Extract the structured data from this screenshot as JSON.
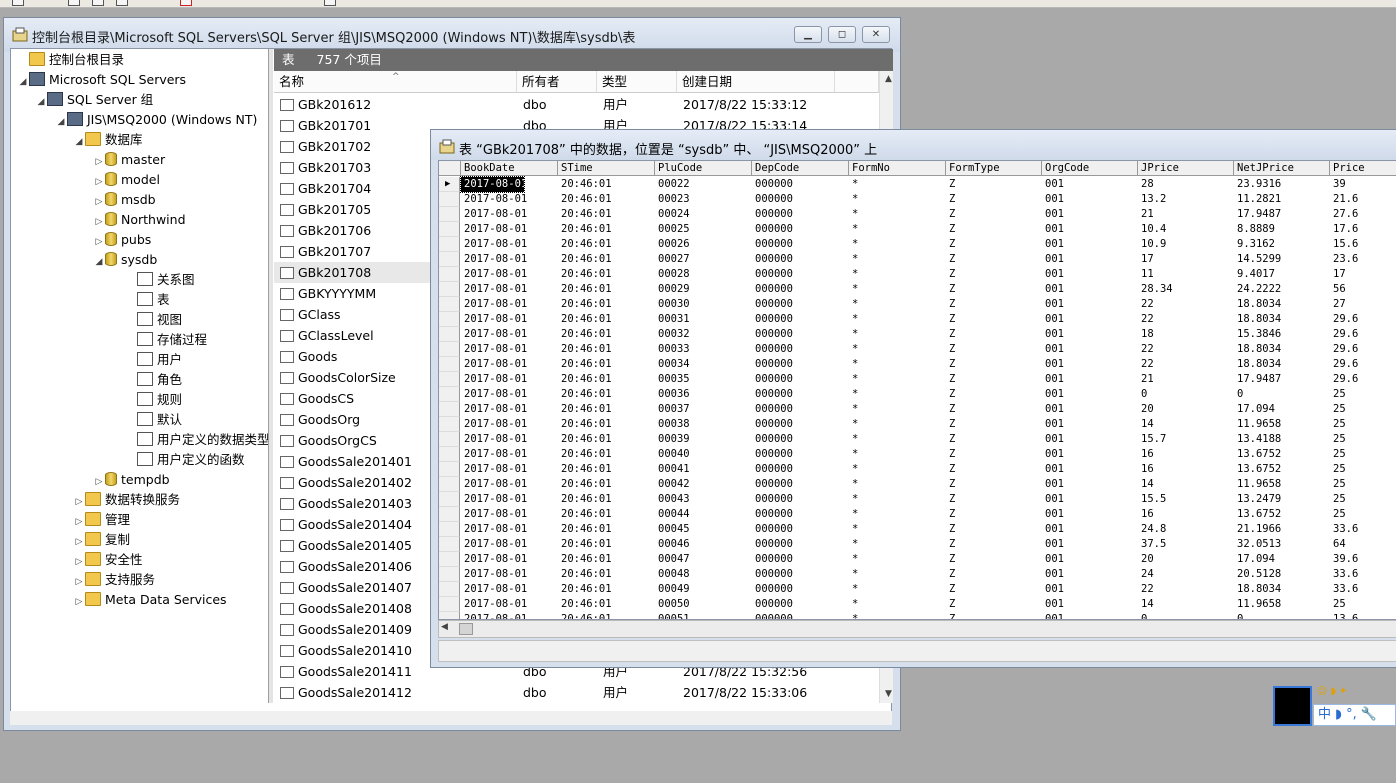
{
  "main_window": {
    "title": "控制台根目录\\Microsoft SQL Servers\\SQL Server 组\\JIS\\MSQ2000 (Windows NT)\\数据库\\sysdb\\表"
  },
  "tree": {
    "items": [
      {
        "label": "控制台根目录",
        "exp": "",
        "icon": "folder"
      },
      {
        "label": "Microsoft SQL Servers",
        "exp": "◢",
        "icon": "srv"
      },
      {
        "label": "SQL Server 组",
        "exp": "◢",
        "icon": "srv"
      },
      {
        "label": "JIS\\MSQ2000 (Windows NT)",
        "exp": "◢",
        "icon": "srv"
      },
      {
        "label": "数据库",
        "exp": "◢",
        "icon": "folder"
      },
      {
        "label": "master",
        "exp": "▷",
        "icon": "db"
      },
      {
        "label": "model",
        "exp": "▷",
        "icon": "db"
      },
      {
        "label": "msdb",
        "exp": "▷",
        "icon": "db"
      },
      {
        "label": "Northwind",
        "exp": "▷",
        "icon": "db"
      },
      {
        "label": "pubs",
        "exp": "▷",
        "icon": "db"
      },
      {
        "label": "sysdb",
        "exp": "◢",
        "icon": "db"
      },
      {
        "label": "关系图",
        "exp": "",
        "icon": "box"
      },
      {
        "label": "表",
        "exp": "",
        "icon": "box"
      },
      {
        "label": "视图",
        "exp": "",
        "icon": "box"
      },
      {
        "label": "存储过程",
        "exp": "",
        "icon": "box"
      },
      {
        "label": "用户",
        "exp": "",
        "icon": "box"
      },
      {
        "label": "角色",
        "exp": "",
        "icon": "box"
      },
      {
        "label": "规则",
        "exp": "",
        "icon": "box"
      },
      {
        "label": "默认",
        "exp": "",
        "icon": "box"
      },
      {
        "label": "用户定义的数据类型",
        "exp": "",
        "icon": "box"
      },
      {
        "label": "用户定义的函数",
        "exp": "",
        "icon": "box"
      },
      {
        "label": "tempdb",
        "exp": "▷",
        "icon": "db"
      },
      {
        "label": "数据转换服务",
        "exp": "▷",
        "icon": "folder"
      },
      {
        "label": "管理",
        "exp": "▷",
        "icon": "folder"
      },
      {
        "label": "复制",
        "exp": "▷",
        "icon": "folder"
      },
      {
        "label": "安全性",
        "exp": "▷",
        "icon": "folder"
      },
      {
        "label": "支持服务",
        "exp": "▷",
        "icon": "folder"
      },
      {
        "label": "Meta Data Services",
        "exp": "▷",
        "icon": "folder"
      }
    ]
  },
  "list": {
    "header_label": "表",
    "count_label": "757 个项目",
    "columns": [
      "名称",
      "所有者",
      "类型",
      "创建日期"
    ],
    "rows": [
      [
        "GBk201612",
        "dbo",
        "用户",
        "2017/8/22 15:33:12"
      ],
      [
        "GBk201701",
        "dbo",
        "用户",
        "2017/8/22 15:33:14"
      ],
      [
        "GBk201702",
        "",
        "",
        ""
      ],
      [
        "GBk201703",
        "",
        "",
        ""
      ],
      [
        "GBk201704",
        "",
        "",
        ""
      ],
      [
        "GBk201705",
        "",
        "",
        ""
      ],
      [
        "GBk201706",
        "",
        "",
        ""
      ],
      [
        "GBk201707",
        "",
        "",
        ""
      ],
      [
        "GBk201708",
        "",
        "",
        ""
      ],
      [
        "GBKYYYYMM",
        "",
        "",
        ""
      ],
      [
        "GClass",
        "",
        "",
        ""
      ],
      [
        "GClassLevel",
        "",
        "",
        ""
      ],
      [
        "Goods",
        "",
        "",
        ""
      ],
      [
        "GoodsColorSize",
        "",
        "",
        ""
      ],
      [
        "GoodsCS",
        "",
        "",
        ""
      ],
      [
        "GoodsOrg",
        "",
        "",
        ""
      ],
      [
        "GoodsOrgCS",
        "",
        "",
        ""
      ],
      [
        "GoodsSale201401",
        "",
        "",
        ""
      ],
      [
        "GoodsSale201402",
        "",
        "",
        ""
      ],
      [
        "GoodsSale201403",
        "",
        "",
        ""
      ],
      [
        "GoodsSale201404",
        "",
        "",
        ""
      ],
      [
        "GoodsSale201405",
        "",
        "",
        ""
      ],
      [
        "GoodsSale201406",
        "",
        "",
        ""
      ],
      [
        "GoodsSale201407",
        "",
        "",
        ""
      ],
      [
        "GoodsSale201408",
        "",
        "",
        ""
      ],
      [
        "GoodsSale201409",
        "",
        "",
        ""
      ],
      [
        "GoodsSale201410",
        "",
        "",
        ""
      ],
      [
        "GoodsSale201411",
        "dbo",
        "用户",
        "2017/8/22 15:32:56"
      ],
      [
        "GoodsSale201412",
        "dbo",
        "用户",
        "2017/8/22 15:33:06"
      ]
    ]
  },
  "data_window": {
    "title": "表 “GBk201708” 中的数据，位置是 “sysdb” 中、 “JIS\\MSQ2000” 上",
    "columns": [
      "BookDate",
      "STime",
      "PluCode",
      "DepCode",
      "FormNo",
      "FormType",
      "OrgCode",
      "JPrice",
      "NetJPrice",
      "Price"
    ],
    "rows": [
      [
        "2017-08-01",
        "20:46:01",
        "00022",
        "000000",
        "*",
        "Z",
        "001",
        "28",
        "23.9316",
        "39"
      ],
      [
        "2017-08-01",
        "20:46:01",
        "00023",
        "000000",
        "*",
        "Z",
        "001",
        "13.2",
        "11.2821",
        "21.6"
      ],
      [
        "2017-08-01",
        "20:46:01",
        "00024",
        "000000",
        "*",
        "Z",
        "001",
        "21",
        "17.9487",
        "27.6"
      ],
      [
        "2017-08-01",
        "20:46:01",
        "00025",
        "000000",
        "*",
        "Z",
        "001",
        "10.4",
        "8.8889",
        "17.6"
      ],
      [
        "2017-08-01",
        "20:46:01",
        "00026",
        "000000",
        "*",
        "Z",
        "001",
        "10.9",
        "9.3162",
        "15.6"
      ],
      [
        "2017-08-01",
        "20:46:01",
        "00027",
        "000000",
        "*",
        "Z",
        "001",
        "17",
        "14.5299",
        "23.6"
      ],
      [
        "2017-08-01",
        "20:46:01",
        "00028",
        "000000",
        "*",
        "Z",
        "001",
        "11",
        "9.4017",
        "17"
      ],
      [
        "2017-08-01",
        "20:46:01",
        "00029",
        "000000",
        "*",
        "Z",
        "001",
        "28.34",
        "24.2222",
        "56"
      ],
      [
        "2017-08-01",
        "20:46:01",
        "00030",
        "000000",
        "*",
        "Z",
        "001",
        "22",
        "18.8034",
        "27"
      ],
      [
        "2017-08-01",
        "20:46:01",
        "00031",
        "000000",
        "*",
        "Z",
        "001",
        "22",
        "18.8034",
        "29.6"
      ],
      [
        "2017-08-01",
        "20:46:01",
        "00032",
        "000000",
        "*",
        "Z",
        "001",
        "18",
        "15.3846",
        "29.6"
      ],
      [
        "2017-08-01",
        "20:46:01",
        "00033",
        "000000",
        "*",
        "Z",
        "001",
        "22",
        "18.8034",
        "29.6"
      ],
      [
        "2017-08-01",
        "20:46:01",
        "00034",
        "000000",
        "*",
        "Z",
        "001",
        "22",
        "18.8034",
        "29.6"
      ],
      [
        "2017-08-01",
        "20:46:01",
        "00035",
        "000000",
        "*",
        "Z",
        "001",
        "21",
        "17.9487",
        "29.6"
      ],
      [
        "2017-08-01",
        "20:46:01",
        "00036",
        "000000",
        "*",
        "Z",
        "001",
        "0",
        "0",
        "25"
      ],
      [
        "2017-08-01",
        "20:46:01",
        "00037",
        "000000",
        "*",
        "Z",
        "001",
        "20",
        "17.094",
        "25"
      ],
      [
        "2017-08-01",
        "20:46:01",
        "00038",
        "000000",
        "*",
        "Z",
        "001",
        "14",
        "11.9658",
        "25"
      ],
      [
        "2017-08-01",
        "20:46:01",
        "00039",
        "000000",
        "*",
        "Z",
        "001",
        "15.7",
        "13.4188",
        "25"
      ],
      [
        "2017-08-01",
        "20:46:01",
        "00040",
        "000000",
        "*",
        "Z",
        "001",
        "16",
        "13.6752",
        "25"
      ],
      [
        "2017-08-01",
        "20:46:01",
        "00041",
        "000000",
        "*",
        "Z",
        "001",
        "16",
        "13.6752",
        "25"
      ],
      [
        "2017-08-01",
        "20:46:01",
        "00042",
        "000000",
        "*",
        "Z",
        "001",
        "14",
        "11.9658",
        "25"
      ],
      [
        "2017-08-01",
        "20:46:01",
        "00043",
        "000000",
        "*",
        "Z",
        "001",
        "15.5",
        "13.2479",
        "25"
      ],
      [
        "2017-08-01",
        "20:46:01",
        "00044",
        "000000",
        "*",
        "Z",
        "001",
        "16",
        "13.6752",
        "25"
      ],
      [
        "2017-08-01",
        "20:46:01",
        "00045",
        "000000",
        "*",
        "Z",
        "001",
        "24.8",
        "21.1966",
        "33.6"
      ],
      [
        "2017-08-01",
        "20:46:01",
        "00046",
        "000000",
        "*",
        "Z",
        "001",
        "37.5",
        "32.0513",
        "64"
      ],
      [
        "2017-08-01",
        "20:46:01",
        "00047",
        "000000",
        "*",
        "Z",
        "001",
        "20",
        "17.094",
        "39.6"
      ],
      [
        "2017-08-01",
        "20:46:01",
        "00048",
        "000000",
        "*",
        "Z",
        "001",
        "24",
        "20.5128",
        "33.6"
      ],
      [
        "2017-08-01",
        "20:46:01",
        "00049",
        "000000",
        "*",
        "Z",
        "001",
        "22",
        "18.8034",
        "33.6"
      ],
      [
        "2017-08-01",
        "20:46:01",
        "00050",
        "000000",
        "*",
        "Z",
        "001",
        "14",
        "11.9658",
        "25"
      ],
      [
        "2017-08-01",
        "20:46:01",
        "00051",
        "000000",
        "*",
        "Z",
        "001",
        "0",
        "0",
        "13.6"
      ]
    ]
  },
  "ime": {
    "label": "中 ◗ °, 🔧"
  }
}
